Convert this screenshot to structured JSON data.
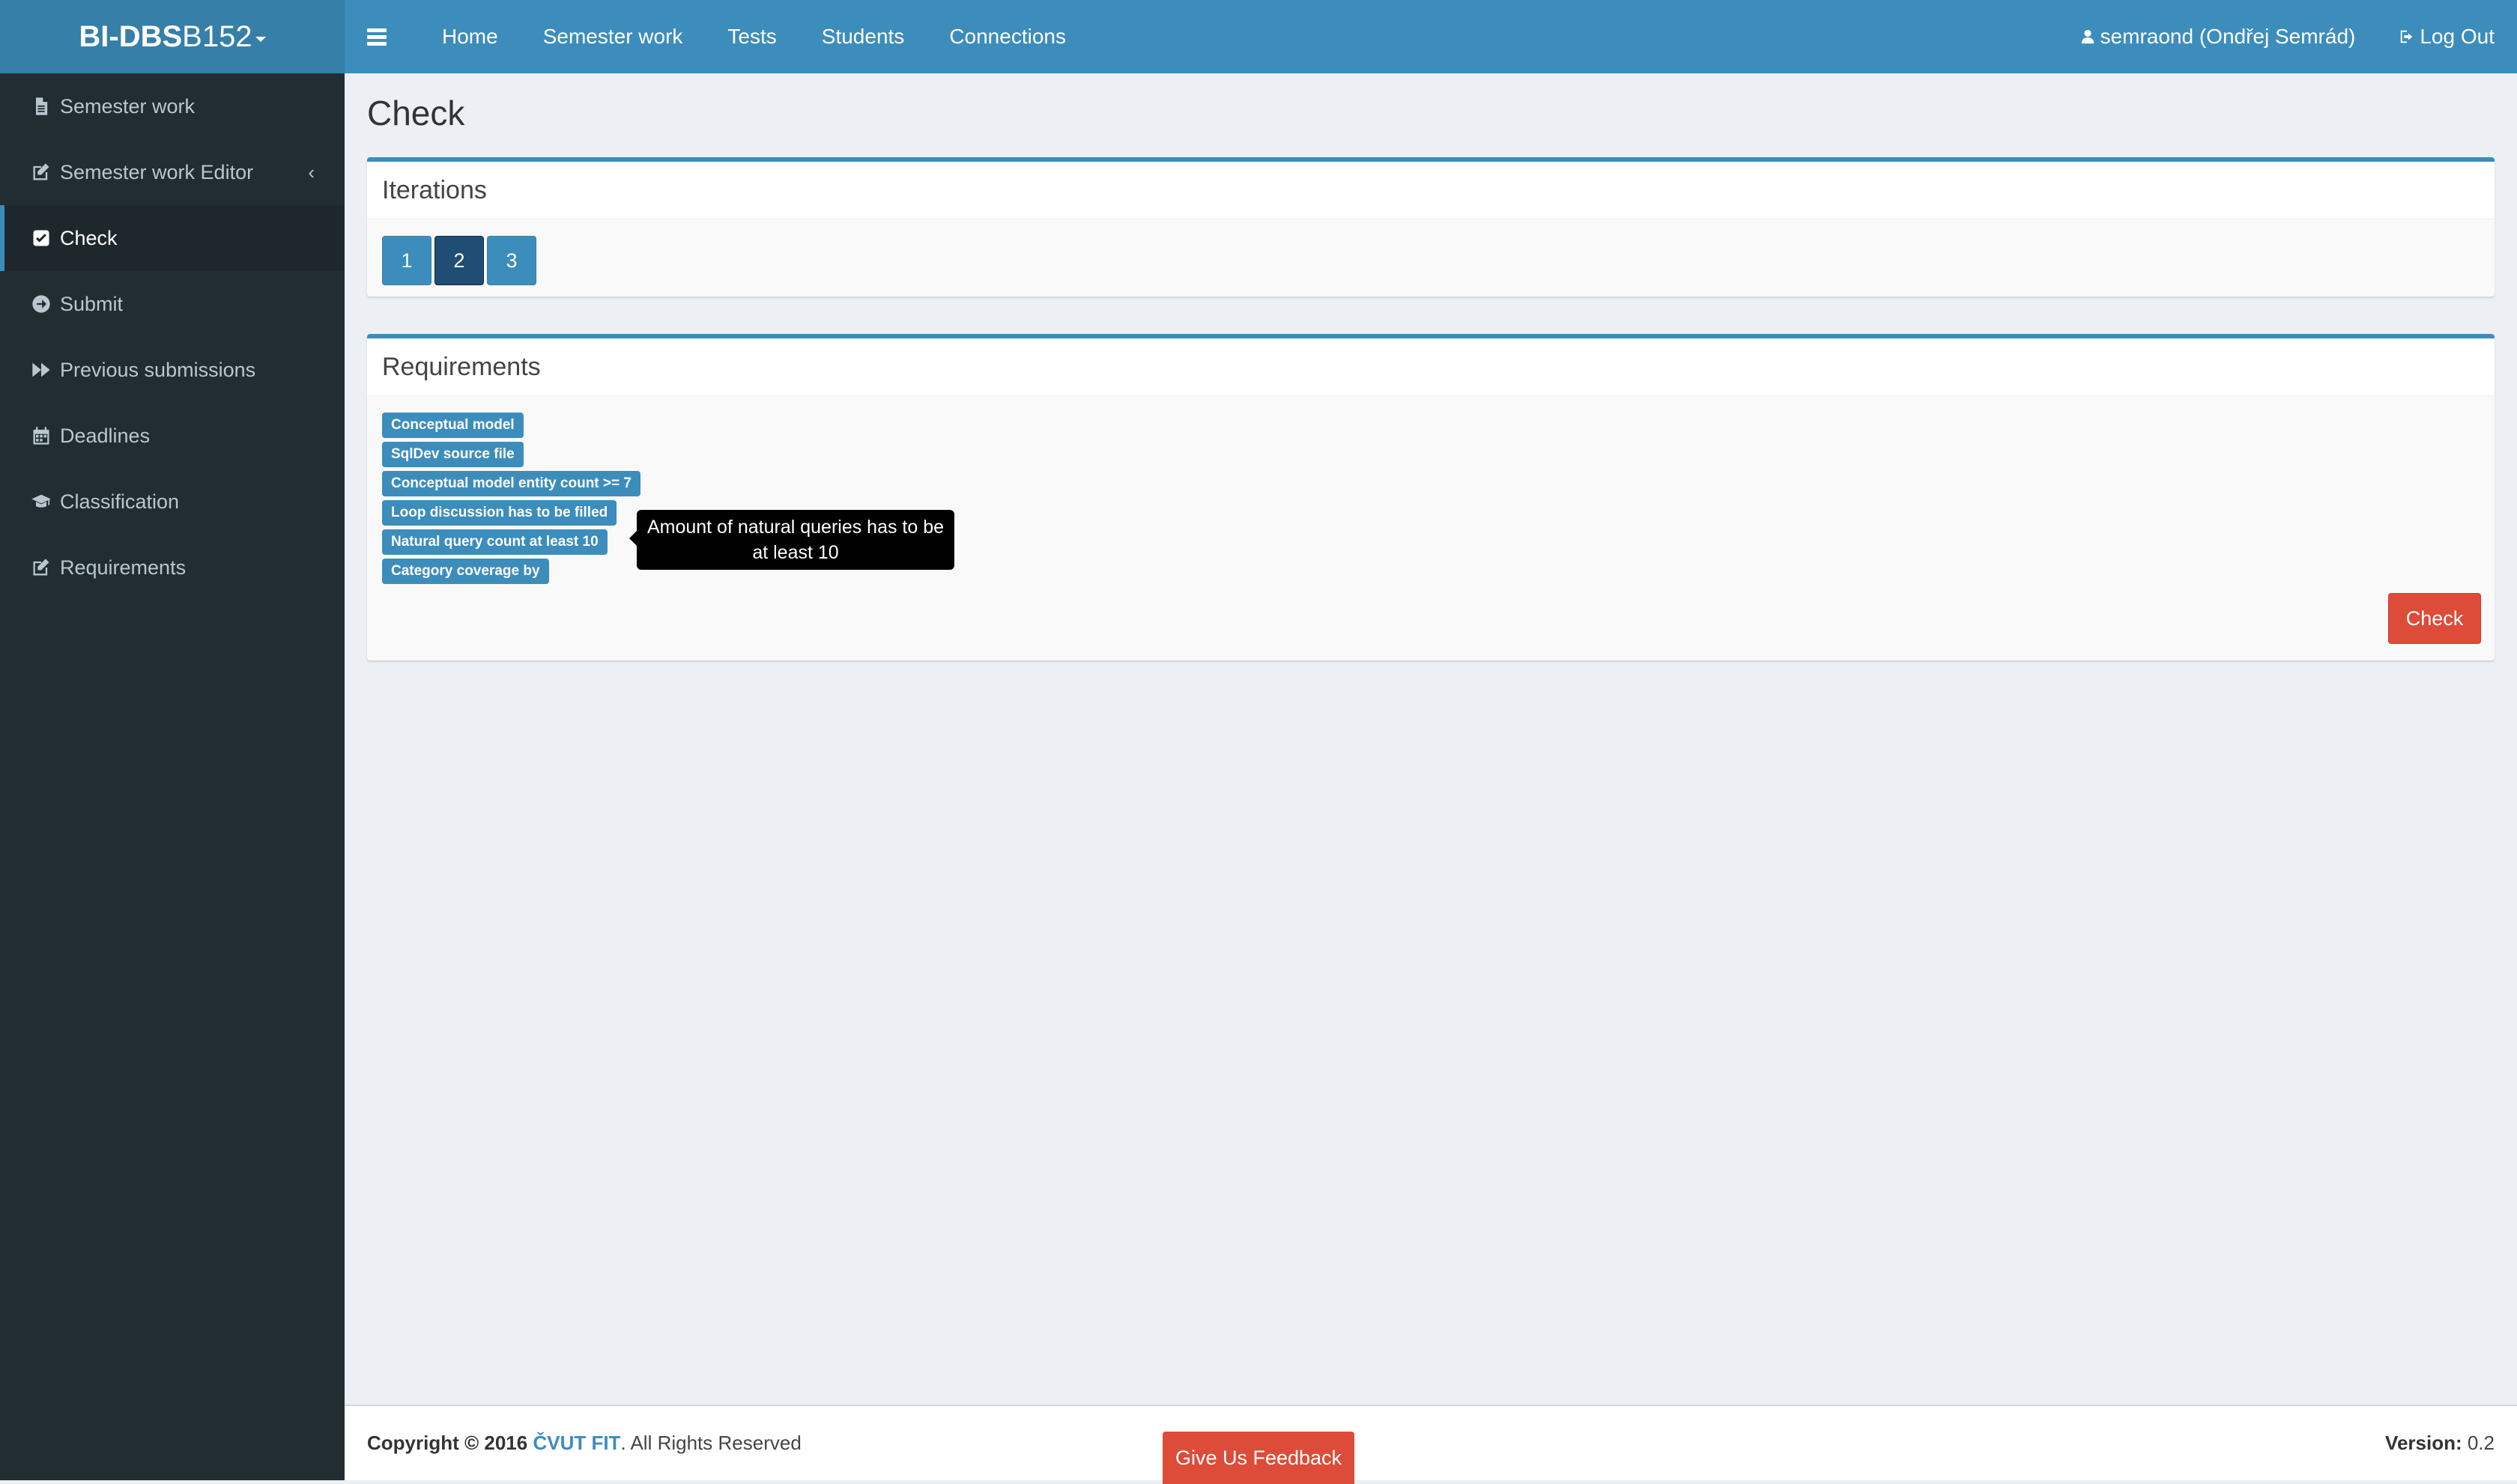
{
  "app": {
    "brand_bold": "BI-DBS",
    "brand_rest": " B152"
  },
  "sidebar": {
    "items": [
      {
        "label": "Semester work",
        "icon": "file-icon"
      },
      {
        "label": "Semester work Editor",
        "icon": "edit-icon"
      },
      {
        "label": "Check",
        "icon": "check-square-icon",
        "active": true
      },
      {
        "label": "Submit",
        "icon": "arrow-circle-right-icon"
      },
      {
        "label": "Previous submissions",
        "icon": "fast-forward-icon"
      },
      {
        "label": "Deadlines",
        "icon": "calendar-icon"
      },
      {
        "label": "Classification",
        "icon": "graduation-cap-icon"
      },
      {
        "label": "Requirements",
        "icon": "edit-icon"
      }
    ]
  },
  "topbar": {
    "nav": [
      "Home",
      "Semester work",
      "Tests",
      "Students",
      "Connections"
    ],
    "user": "semraond (Ondřej Semrád)",
    "logout": "Log Out"
  },
  "page": {
    "title": "Check"
  },
  "iterations": {
    "title": "Iterations",
    "pages": [
      "1",
      "2",
      "3"
    ],
    "active": "2"
  },
  "requirements": {
    "title": "Requirements",
    "items": [
      "Conceptual model",
      "SqlDev source file",
      "Conceptual model entity count >= 7",
      "Loop discussion has to be filled",
      "Natural query count at least 10",
      "Category coverage by"
    ],
    "tooltip": "Amount of natural queries has to be at least 10",
    "check_button": "Check"
  },
  "footer": {
    "copyright_prefix": "Copyright © 2016",
    "org": "ČVUT FIT",
    "rights": ". All Rights Reserved",
    "feedback": "Give Us Feedback",
    "version_label": "Version:",
    "version_value": " 0.2"
  },
  "colors": {
    "primary": "#3c8dbc",
    "sidebar_bg": "#222d32",
    "danger": "#dd4b39",
    "active_page": "#204d74"
  }
}
